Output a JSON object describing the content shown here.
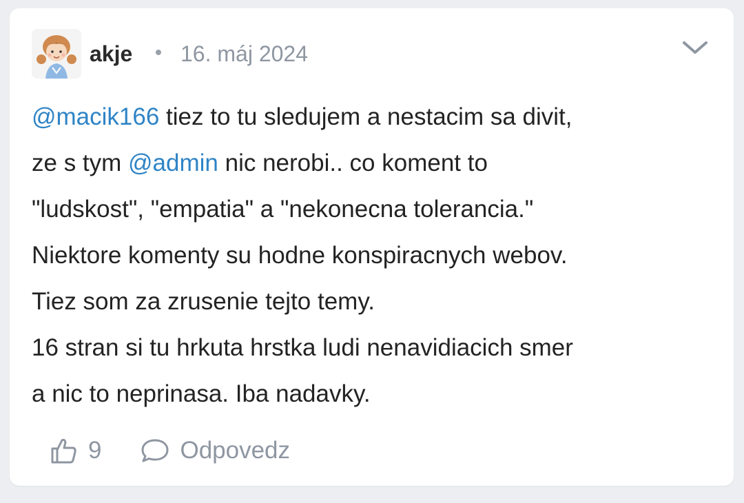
{
  "comment": {
    "author": "akje",
    "separator": "•",
    "date": "16. máj 2024",
    "lines": [
      [
        {
          "text": "@macik166",
          "mention": true
        },
        {
          "text": " tiez to tu sledujem a nestacim sa divit,",
          "mention": false
        }
      ],
      [
        {
          "text": "ze s tym ",
          "mention": false
        },
        {
          "text": "@admin",
          "mention": true
        },
        {
          "text": " nic nerobi.. co koment to",
          "mention": false
        }
      ],
      [
        {
          "text": "\"ludskost\", \"empatia\" a \"nekonecna tolerancia.\"",
          "mention": false
        }
      ],
      [
        {
          "text": "Niektore komenty su hodne konspiracnych webov.",
          "mention": false
        }
      ],
      [
        {
          "text": "Tiez som za zrusenie tejto temy.",
          "mention": false
        }
      ],
      [
        {
          "text": "16 stran si tu hrkuta hrstka ludi nenavidiacich smer",
          "mention": false
        }
      ],
      [
        {
          "text": "a nic to neprinasa. Iba nadavky.",
          "mention": false
        }
      ]
    ],
    "likes": "9",
    "reply_label": "Odpovedz"
  },
  "icons": {
    "expand": "chevron-down-icon",
    "like": "thumbs-up-icon",
    "reply": "speech-bubble-icon"
  },
  "colors": {
    "mention": "#2f84c6",
    "muted": "#8e96a1",
    "text": "#232323",
    "background": "#eceef1",
    "card": "#ffffff"
  }
}
